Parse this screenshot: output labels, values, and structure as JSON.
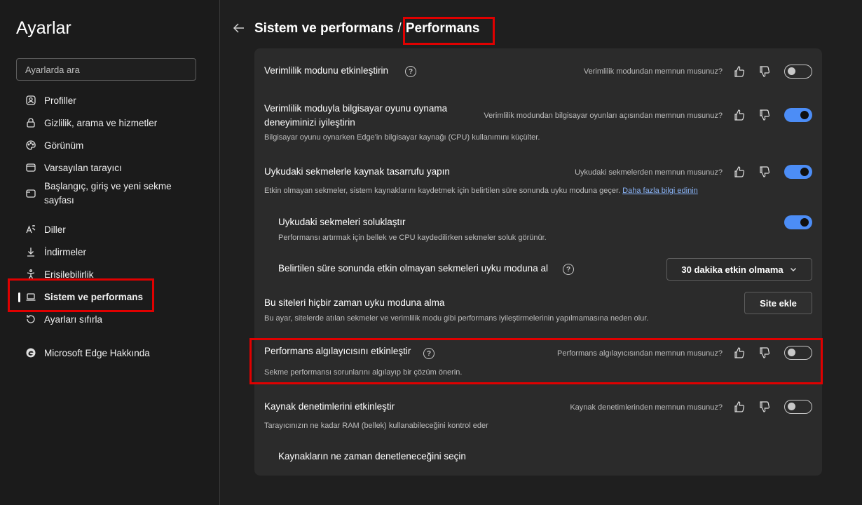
{
  "sidebar": {
    "title": "Ayarlar",
    "search_placeholder": "Ayarlarda ara",
    "items": [
      {
        "label": "Profiller",
        "icon": "profile-icon"
      },
      {
        "label": "Gizlilik, arama ve hizmetler",
        "icon": "lock-icon"
      },
      {
        "label": "Görünüm",
        "icon": "palette-icon"
      },
      {
        "label": "Varsayılan tarayıcı",
        "icon": "browser-icon"
      },
      {
        "label": "Başlangıç, giriş ve yeni sekme sayfası",
        "icon": "home-icon"
      },
      {
        "label": "Diller",
        "icon": "language-icon"
      },
      {
        "label": "İndirmeler",
        "icon": "download-icon"
      },
      {
        "label": "Erişilebilirlik",
        "icon": "accessibility-icon"
      },
      {
        "label": "Sistem ve performans",
        "icon": "laptop-icon"
      },
      {
        "label": "Ayarları sıfırla",
        "icon": "reset-icon"
      },
      {
        "label": "Microsoft Edge Hakkında",
        "icon": "edge-logo-icon"
      }
    ]
  },
  "header": {
    "parent": "Sistem ve performans",
    "separator": "/",
    "current": "Performans"
  },
  "settings": {
    "efficiency": {
      "title": "Verimlilik modunu etkinleştirin",
      "feedback": "Verimlilik modundan memnun musunuz?",
      "enabled": false
    },
    "gaming": {
      "title": "Verimlilik moduyla bilgisayar oyunu oynama deneyiminizi iyileştirin",
      "desc": "Bilgisayar oyunu oynarken Edge'in bilgisayar kaynağı (CPU) kullanımını küçülter.",
      "feedback": "Verimlilik modundan bilgisayar oyunları açısından memnun musunuz?",
      "enabled": true
    },
    "sleeping": {
      "title": "Uykudaki sekmelerle kaynak tasarrufu yapın",
      "desc": "Etkin olmayan sekmeler, sistem kaynaklarını kaydetmek için belirtilen süre sonunda uyku moduna geçer.",
      "link": "Daha fazla bilgi edinin",
      "feedback": "Uykudaki sekmelerden memnun musunuz?",
      "enabled": true
    },
    "fade": {
      "title": "Uykudaki sekmeleri soluklaştır",
      "desc": "Performansı artırmak için bellek ve CPU kaydedilirken sekmeler soluk görünür.",
      "enabled": true
    },
    "sleep_after": {
      "title": "Belirtilen süre sonunda etkin olmayan sekmeleri uyku moduna al",
      "selected": "30 dakika etkin olmama"
    },
    "never_sleep": {
      "title": "Bu siteleri hiçbir zaman uyku moduna alma",
      "desc": "Bu ayar, sitelerde atılan sekmeler ve verimlilik modu gibi performans iyileştirmelerinin yapılmamasına neden olur.",
      "button": "Site ekle"
    },
    "detector": {
      "title": "Performans algılayıcısını etkinleştir",
      "desc": "Sekme performansı sorunlarını algılayıp bir çözüm önerin.",
      "feedback": "Performans algılayıcısından memnun musunuz?",
      "enabled": false
    },
    "resource": {
      "title": "Kaynak denetimlerini etkinleştir",
      "desc": "Tarayıcınızın ne kadar RAM (bellek) kullanabileceğini kontrol eder",
      "feedback": "Kaynak denetimlerinden memnun musunuz?",
      "enabled": false
    },
    "resource_when": {
      "title": "Kaynakların ne zaman denetleneceğini seçin"
    }
  },
  "help_glyph": "?",
  "colors": {
    "accent": "#4c8df6",
    "highlight": "#e00000",
    "background": "#1f1f1f",
    "card": "#2b2b2b"
  }
}
